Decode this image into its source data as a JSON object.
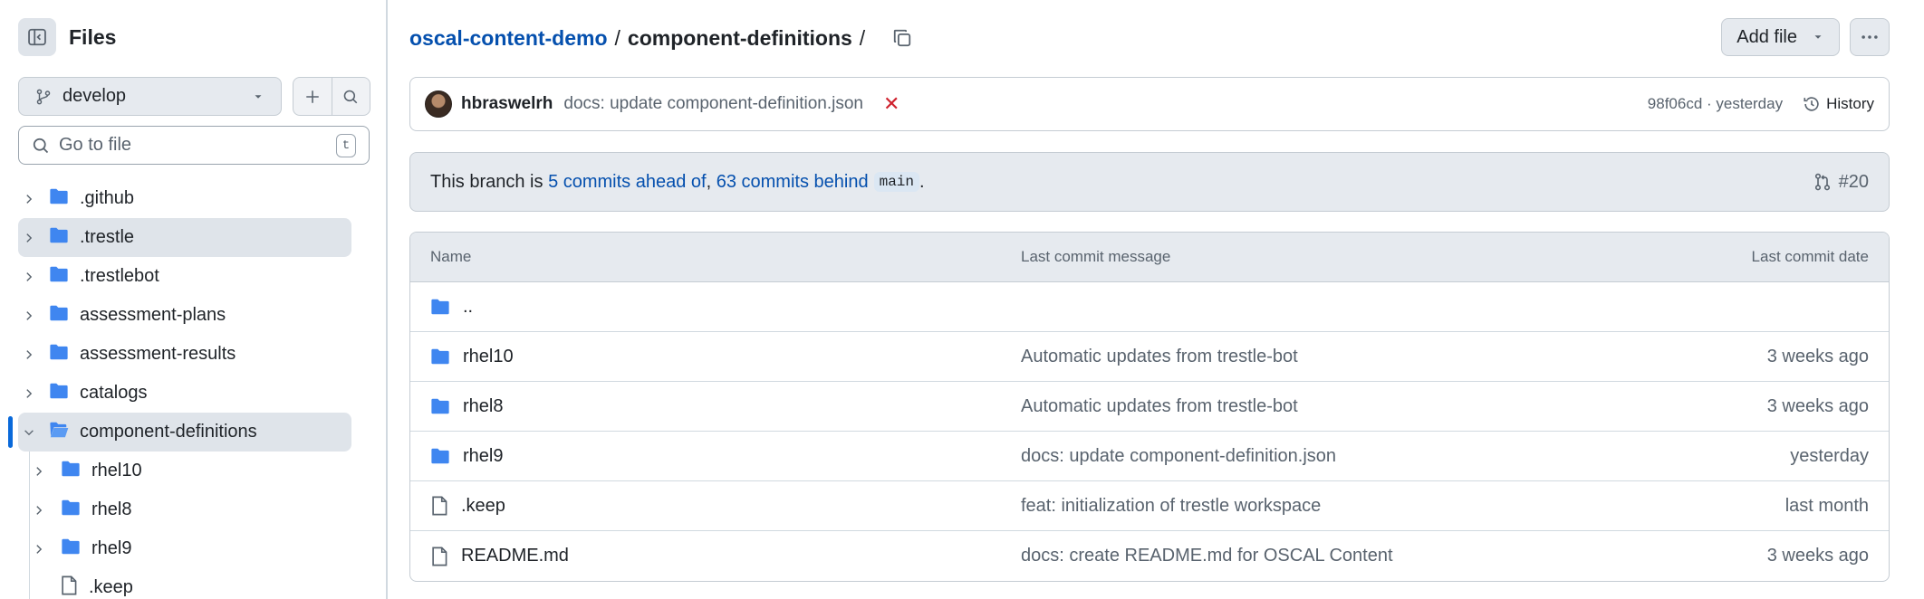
{
  "sidebar": {
    "title": "Files",
    "branch": "develop",
    "goto_placeholder": "Go to file",
    "goto_shortcut": "t",
    "tree": [
      {
        "name": ".github",
        "type": "folder"
      },
      {
        "name": ".trestle",
        "type": "folder"
      },
      {
        "name": ".trestlebot",
        "type": "folder"
      },
      {
        "name": "assessment-plans",
        "type": "folder"
      },
      {
        "name": "assessment-results",
        "type": "folder"
      },
      {
        "name": "catalogs",
        "type": "folder"
      },
      {
        "name": "component-definitions",
        "type": "folder",
        "expanded": true,
        "active": true
      },
      {
        "name": "rhel10",
        "type": "folder",
        "level": 2
      },
      {
        "name": "rhel8",
        "type": "folder",
        "level": 2
      },
      {
        "name": "rhel9",
        "type": "folder",
        "level": 2
      },
      {
        "name": ".keep",
        "type": "file",
        "level": 2
      }
    ]
  },
  "breadcrumb": {
    "repo": "oscal-content-demo",
    "separator": "/",
    "current": "component-definitions",
    "trailing_separator": "/"
  },
  "actions": {
    "add_file": "Add file"
  },
  "commit": {
    "author": "hbraswelrh",
    "message": "docs: update component-definition.json",
    "status": "✕",
    "sha_time": "98f06cd · yesterday",
    "history": "History"
  },
  "branch_info": {
    "prefix": "This branch is ",
    "ahead": "5 commits ahead of",
    "comma": ", ",
    "behind": "63 commits behind",
    "base": "main",
    "suffix": ".",
    "pr": "#20"
  },
  "table": {
    "headers": {
      "name": "Name",
      "message": "Last commit message",
      "date": "Last commit date"
    },
    "parent": "..",
    "rows": [
      {
        "name": "rhel10",
        "type": "folder",
        "message": "Automatic updates from trestle-bot",
        "date": "3 weeks ago"
      },
      {
        "name": "rhel8",
        "type": "folder",
        "message": "Automatic updates from trestle-bot",
        "date": "3 weeks ago"
      },
      {
        "name": "rhel9",
        "type": "folder",
        "message": "docs: update component-definition.json",
        "date": "yesterday"
      },
      {
        "name": ".keep",
        "type": "file",
        "message": "feat: initialization of trestle workspace",
        "date": "last month"
      },
      {
        "name": "README.md",
        "type": "file",
        "message": "docs: create README.md for OSCAL Content",
        "date": "3 weeks ago"
      }
    ]
  },
  "colors": {
    "link": "#0550ae",
    "folder": "#3f86f0",
    "active_indicator": "#0969da",
    "error": "#cf222e"
  }
}
